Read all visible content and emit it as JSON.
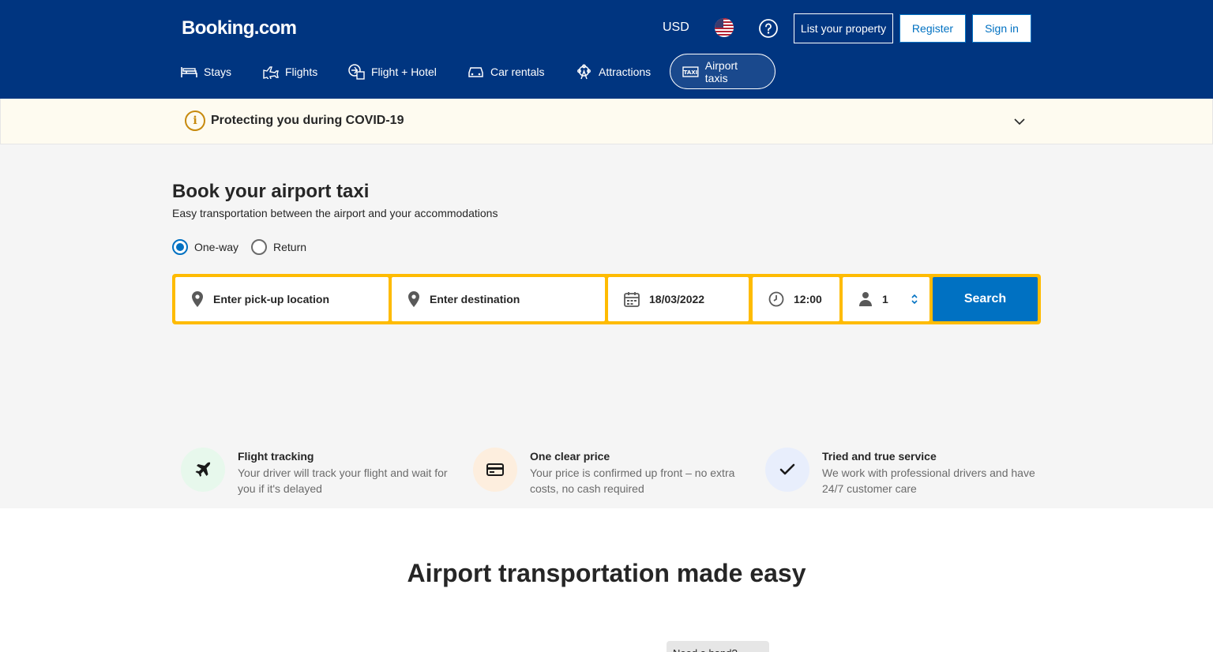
{
  "header": {
    "logo": "Booking.com",
    "currency": "USD",
    "list_property": "List your property",
    "register": "Register",
    "sign_in": "Sign in"
  },
  "nav": [
    {
      "label": "Stays",
      "icon": "bed-icon"
    },
    {
      "label": "Flights",
      "icon": "plane-icon"
    },
    {
      "label": "Flight + Hotel",
      "icon": "plane-hotel-icon"
    },
    {
      "label": "Car rentals",
      "icon": "car-icon"
    },
    {
      "label": "Attractions",
      "icon": "ferris-wheel-icon"
    },
    {
      "label": "Airport taxis",
      "icon": "taxi-icon",
      "active": true
    }
  ],
  "covid": {
    "text": "Protecting you during COVID-19"
  },
  "hero": {
    "title": "Book your airport taxi",
    "subtitle": "Easy transportation between the airport and your accommodations",
    "trip_options": [
      "One-way",
      "Return"
    ],
    "selected_trip": "One-way"
  },
  "search": {
    "pickup_placeholder": "Enter pick-up location",
    "destination_placeholder": "Enter destination",
    "date": "18/03/2022",
    "time": "12:00",
    "passengers": "1",
    "button": "Search"
  },
  "features": [
    {
      "title": "Flight tracking",
      "desc": "Your driver will track your flight and wait for you if it's delayed"
    },
    {
      "title": "One clear price",
      "desc": "Your price is confirmed up front – no extra costs, no cash required"
    },
    {
      "title": "Tried and true service",
      "desc": "We work with professional drivers and have 24/7 customer care"
    }
  ],
  "section": {
    "title": "Airport transportation made easy"
  },
  "need_help": "Need a hand?",
  "colors": {
    "brand_blue": "#003580",
    "action_blue": "#0071c2",
    "search_border": "#febb02"
  }
}
